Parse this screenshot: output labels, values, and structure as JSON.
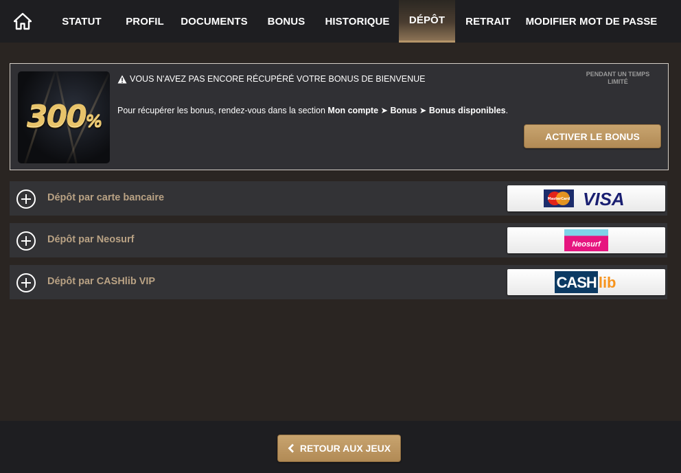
{
  "nav": {
    "home_icon": "home-icon",
    "tabs": [
      {
        "label": "STATUT"
      },
      {
        "label": "PROFIL"
      },
      {
        "label": "DOCUMENTS"
      },
      {
        "label": "BONUS"
      },
      {
        "label": "HISTORIQUE"
      },
      {
        "label": "DÉPÔT",
        "active": true
      },
      {
        "label": "RETRAIT"
      },
      {
        "label": "MODIFIER MOT DE PASSE"
      }
    ]
  },
  "bonus": {
    "image_number": "300",
    "image_unit": "%",
    "warning_icon": "warning-icon",
    "warning": "VOUS N'AVEZ PAS ENCORE RÉCUPÉRÉ VOTRE BONUS DE BIENVENUE",
    "text_prefix": "Pour récupérer les bonus, rendez-vous dans la section ",
    "path_1": "Mon compte",
    "path_2": "Bonus",
    "path_3": "Bonus disponibles",
    "text_suffix": ".",
    "limited": "PENDANT UN TEMPS LIMITÉ",
    "activate_label": "ACTIVER LE BONUS"
  },
  "deposits": [
    {
      "label": "Dépôt par carte bancaire",
      "logo": "mastercard-visa-logo",
      "mc_text": "MasterCard",
      "visa_text": "VISA"
    },
    {
      "label": "Dépôt par Neosurf",
      "logo": "neosurf-logo",
      "logo_text": "Neosurf"
    },
    {
      "label": "Dépôt par CASHlib VIP",
      "logo": "cashlib-logo",
      "logo_text_1": "CASH",
      "logo_text_2": "lib"
    }
  ],
  "footer": {
    "back_label": "RETOUR AUX JEUX",
    "back_icon": "chevron-left-icon"
  },
  "colors": {
    "background": "#2a2522",
    "nav_background": "#1e1e21",
    "accent_gold": "#c19d68",
    "label_gold": "#b9a284",
    "row_background": "#333336"
  }
}
